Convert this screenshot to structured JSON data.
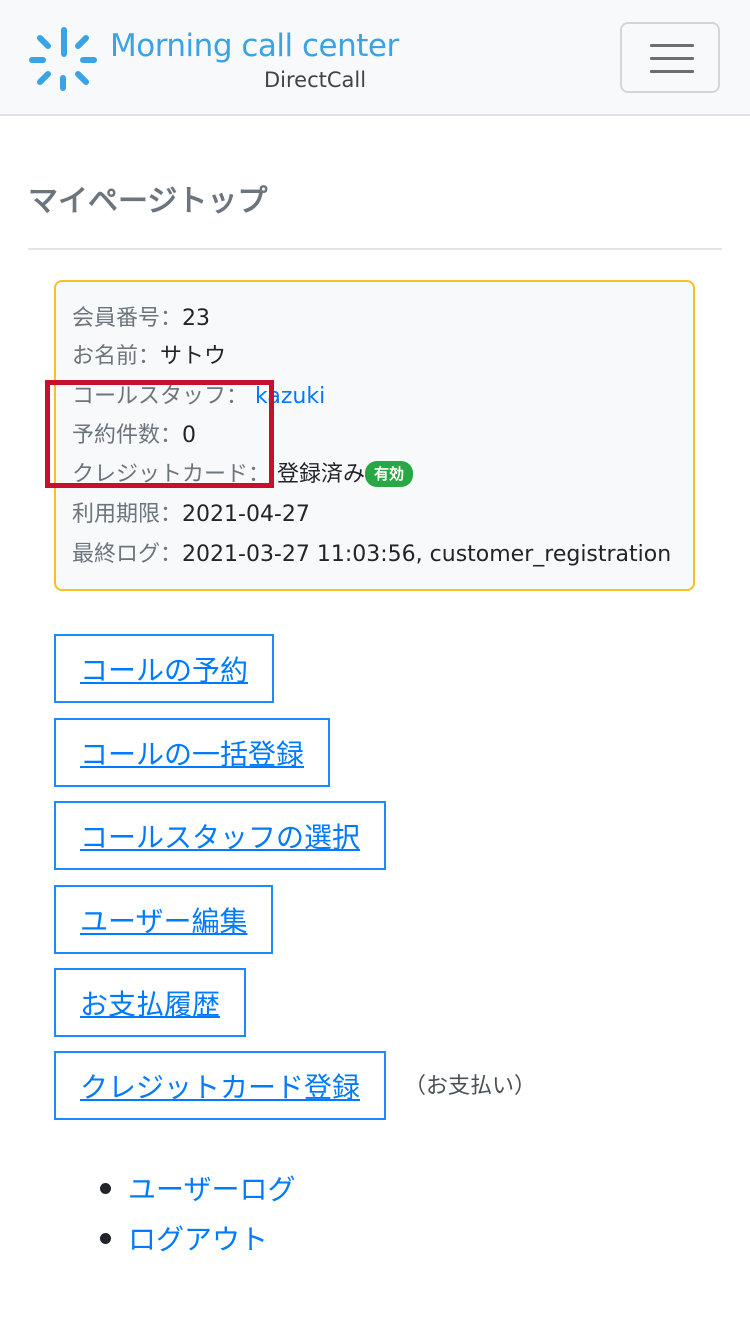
{
  "header": {
    "logo_title": "Morning call center",
    "logo_subtitle": "DirectCall",
    "logo_icon": "sun-burst-icon",
    "menu_icon": "hamburger-menu-icon"
  },
  "page": {
    "title": "マイページトップ"
  },
  "member_info": {
    "member_no_label": "会員番号：",
    "member_no": "23",
    "name_label": "お名前：",
    "name": "サトウ",
    "staff_label": "コールスタッフ：",
    "staff": "kazuki",
    "reservations_label": "予約件数：",
    "reservations": "0",
    "card_label": "クレジットカード：",
    "card_status": "登録済み",
    "card_badge": "有効",
    "expiry_label": "利用期限：",
    "expiry": "2021-04-27",
    "last_log_label": "最終ログ：",
    "last_log": "2021-03-27 11:03:56, customer_registration"
  },
  "actions": {
    "reserve_call": "コールの予約",
    "bulk_register": "コールの一括登録",
    "select_staff": "コールスタッフの選択",
    "edit_user": "ユーザー編集",
    "payment_history": "お支払履歴",
    "register_card": "クレジットカード登録",
    "register_card_note": "（お支払い）"
  },
  "links": {
    "user_log": "ユーザーログ",
    "logout": "ログアウト"
  },
  "colors": {
    "primary": "#007bff",
    "logo_blue": "#3aa3e6",
    "card_border": "#f5c02a",
    "badge_green": "#28a745",
    "highlight": "#c8102e"
  }
}
